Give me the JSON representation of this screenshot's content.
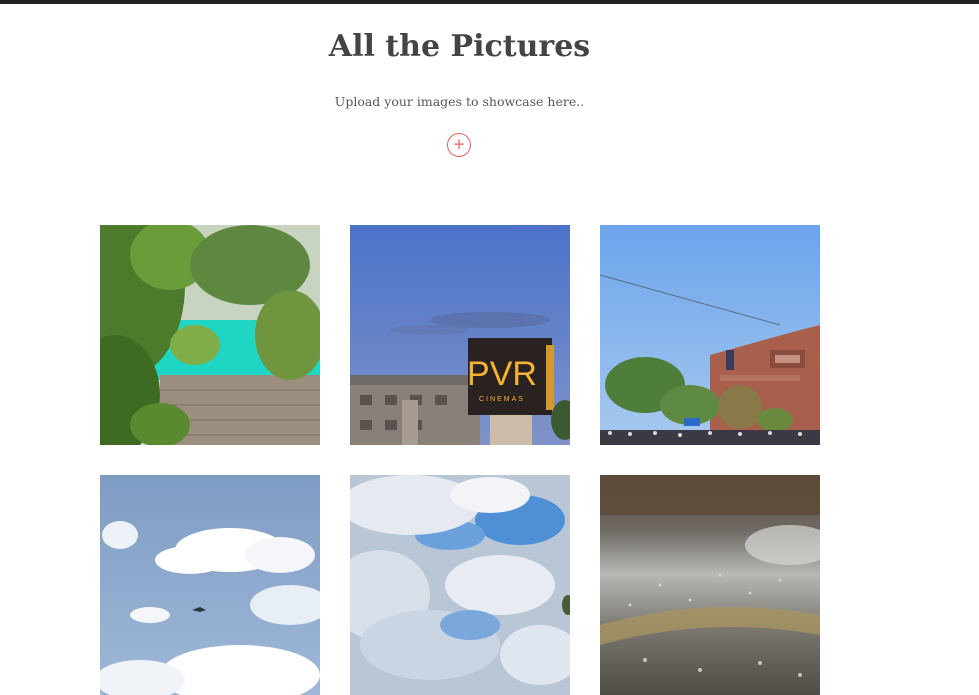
{
  "header": {
    "title": "All the Pictures",
    "subtitle": "Upload your images to showcase here..",
    "upload_label": "+"
  },
  "colors": {
    "accent": "#e8605c",
    "topbar": "#222222",
    "text": "#444444"
  },
  "gallery": {
    "images": [
      {
        "name": "trees-and-wall",
        "sign_text": ""
      },
      {
        "name": "pvr-cinemas-sign",
        "sign_text": "PVR",
        "sign_subtext": "CINEMAS"
      },
      {
        "name": "brick-building-crowd",
        "sign_text": ""
      },
      {
        "name": "sky-clouds-plane",
        "sign_text": ""
      },
      {
        "name": "blue-sky-clouds",
        "sign_text": ""
      },
      {
        "name": "rain-on-road",
        "sign_text": ""
      }
    ]
  }
}
